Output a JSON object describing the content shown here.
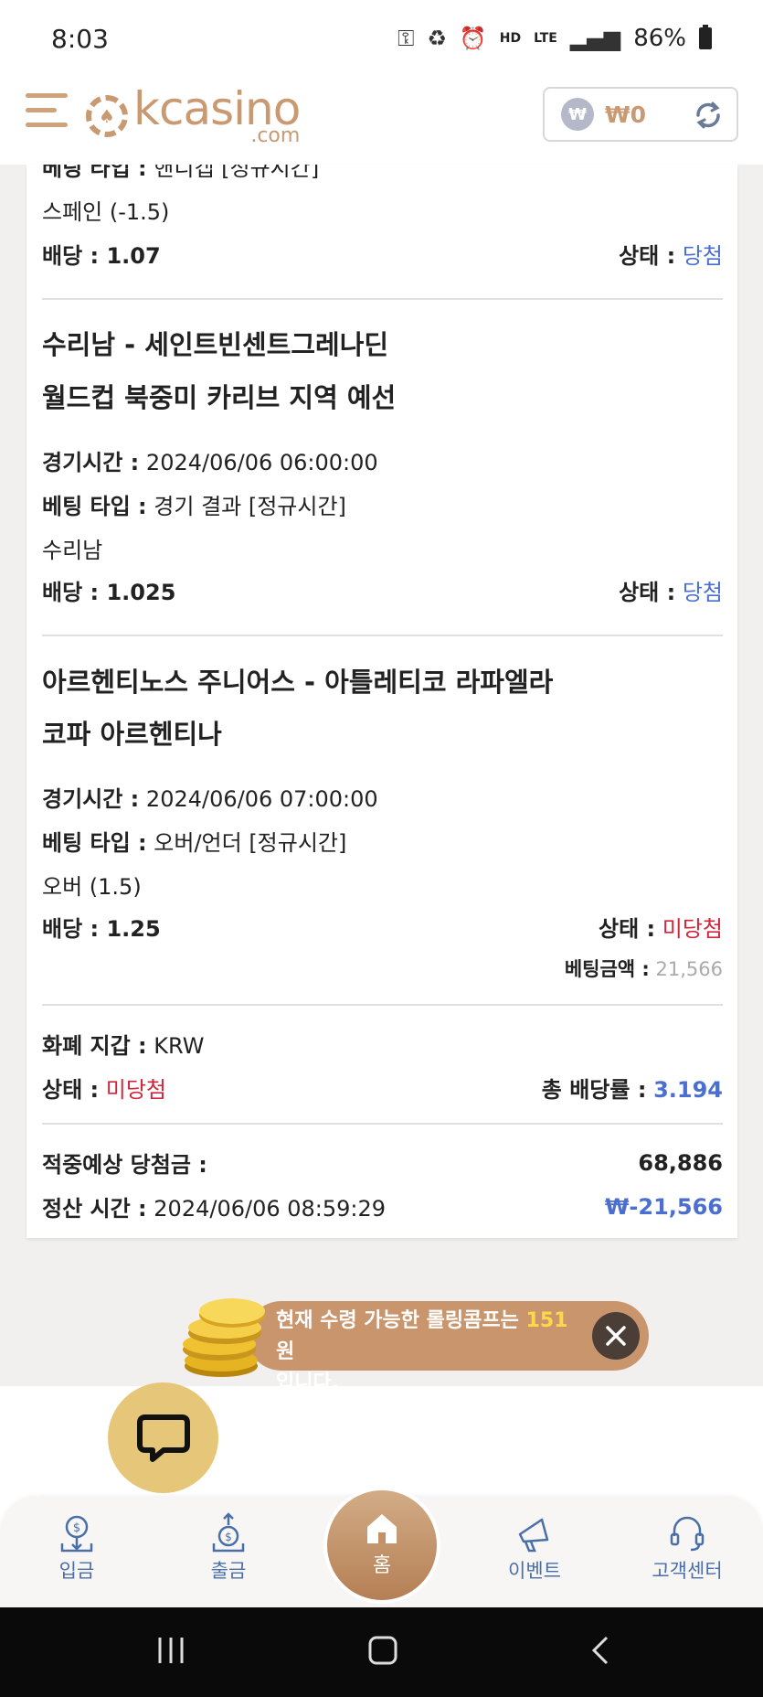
{
  "status_bar": {
    "time": "8:03",
    "hd": "HD",
    "lte": "LTE",
    "battery": "86%"
  },
  "header": {
    "logo_main": "kcasino",
    "logo_sub": ".com",
    "wallet_badge": "₩",
    "wallet_amount": "₩0"
  },
  "bets": [
    {
      "bet_type_label": "베팅 타입 :",
      "bet_type_value": "핸디캡 [정규시간]",
      "pick": "스페인 (-1.5)",
      "odds_label": "배당 :",
      "odds": "1.07",
      "status_label": "상태 :",
      "status": "당첨"
    },
    {
      "title_line1": "수리남 - 세인트빈센트그레나딘",
      "title_line2": "월드컵 북중미 카리브 지역 예선",
      "time_label": "경기시간 :",
      "time": "2024/06/06 06:00:00",
      "bet_type_label": "베팅 타입 :",
      "bet_type_value": "경기 결과 [정규시간]",
      "pick": "수리남",
      "odds_label": "배당 :",
      "odds": "1.025",
      "status_label": "상태 :",
      "status": "당첨"
    },
    {
      "title_line1": "아르헨티노스 주니어스 - 아틀레티코 라파엘라",
      "title_line2": "코파 아르헨티나",
      "time_label": "경기시간 :",
      "time": "2024/06/06 07:00:00",
      "bet_type_label": "베팅 타입 :",
      "bet_type_value": "오버/언더 [정규시간]",
      "pick": "오버 (1.5)",
      "odds_label": "배당 :",
      "odds": "1.25",
      "status_label": "상태 :",
      "status": "미당첨",
      "bet_amount_label": "베팅금액 :",
      "bet_amount": "21,566"
    }
  ],
  "summary": {
    "currency_label": "화폐 지갑 :",
    "currency": "KRW",
    "status_label": "상태 :",
    "status": "미당첨",
    "total_odds_label": "총 배당률 :",
    "total_odds": "3.194",
    "expected_label": "적중예상 당첨금 :",
    "expected": "68,886",
    "settle_label": "정산 시간 :",
    "settle_time": "2024/06/06 08:59:29",
    "settle_amount": "₩-21,566"
  },
  "notice": {
    "text_before": "현재 수령 가능한 롤링콤프는 ",
    "amount": "151",
    "text_after": " 원",
    "line2": "입니다."
  },
  "bottom_nav": {
    "deposit": "입금",
    "withdraw": "출금",
    "home": "홈",
    "event": "이벤트",
    "support": "고객센터"
  },
  "colors": {
    "brand": "#c99a72",
    "win_blue": "#4a6fd1",
    "lose_red": "#d0273d",
    "notice_bg": "#c9956d",
    "chat_bg": "#e6c678"
  }
}
